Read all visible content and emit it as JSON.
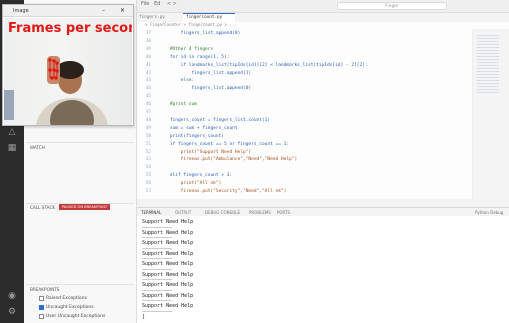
{
  "image_window": {
    "title": "Image",
    "overlay_text": "Frames per second",
    "minimize_glyph": "–",
    "close_glyph": "✕"
  },
  "tabs": {
    "first": "fingers.py",
    "active": "fingercount.py"
  },
  "title_bar": "Finger",
  "breadcrumb": "> FingerCounter > fingercount.py > ...",
  "code_lines": [
    {
      "n": "37",
      "text": "        fingers_list.append(0)",
      "k": ""
    },
    {
      "n": "38",
      "text": "",
      "k": ""
    },
    {
      "n": "39",
      "text": "    #Other 4 fingers",
      "k": "c"
    },
    {
      "n": "40",
      "text": "    for id in range(1, 5):",
      "k": ""
    },
    {
      "n": "41",
      "text": "        if landmarks_list[tipIds[id]][2] < landmarks_list[tipIds[id] - 2][2]:",
      "k": ""
    },
    {
      "n": "42",
      "text": "            fingers_list.append(1)",
      "k": ""
    },
    {
      "n": "43",
      "text": "        else:",
      "k": ""
    },
    {
      "n": "44",
      "text": "            fingers_list.append(0)",
      "k": ""
    },
    {
      "n": "45",
      "text": "",
      "k": ""
    },
    {
      "n": "46",
      "text": "    #print sum",
      "k": "c"
    },
    {
      "n": "47",
      "text": "",
      "k": ""
    },
    {
      "n": "48",
      "text": "    fingers_count = fingers_list.count(1)",
      "k": ""
    },
    {
      "n": "49",
      "text": "    sum = sum + fingers_count",
      "k": ""
    },
    {
      "n": "50",
      "text": "    print(fingers_count)",
      "k": ""
    },
    {
      "n": "51",
      "text": "    if fingers_count == 5 or fingers_count == 1:",
      "k": ""
    },
    {
      "n": "52",
      "text": "        print(\"Support Need Help\")",
      "k": "s"
    },
    {
      "n": "53",
      "text": "        fireeas.put(\"Ambulance\",\"Need\",\"Need Help\")",
      "k": "s"
    },
    {
      "n": "54",
      "text": "",
      "k": ""
    },
    {
      "n": "55",
      "text": "    elif fingers_count > 3:",
      "k": ""
    },
    {
      "n": "56",
      "text": "        print(\"All ok\")",
      "k": "s"
    },
    {
      "n": "57",
      "text": "        fireeas.put(\"Security\",\"Need\",\"All ok\")",
      "k": "s"
    }
  ],
  "sidebar": {
    "watch_header": "WATCH",
    "callstack_header": "CALL STACK",
    "callstack_badge": "PAUSED ON BREAKPOINT",
    "breakpoints_header": "BREAKPOINTS",
    "breakpoints": [
      {
        "label": "Raised Exceptions",
        "checked": false
      },
      {
        "label": "Uncaught Exceptions",
        "checked": true
      },
      {
        "label": "User Uncaught Exceptions",
        "checked": false
      }
    ]
  },
  "panel_tabs": [
    "TERMINAL",
    "OUTPUT",
    "DEBUG CONSOLE",
    "PROBLEMS",
    "PORTS"
  ],
  "panel_right": "Python Debug",
  "terminal_lines": [
    "Support Need Help",
    "Support Need Help",
    "Support Need Help",
    "Support Need Help",
    "Support Need Help",
    "Support Need Help",
    "Support Need Help",
    "Support Need Help",
    "Support Need Help"
  ],
  "prompt": "[",
  "colors": {
    "accent": "#2f6ad0",
    "overlay": "#e01818",
    "badge": "#c43b3b"
  }
}
